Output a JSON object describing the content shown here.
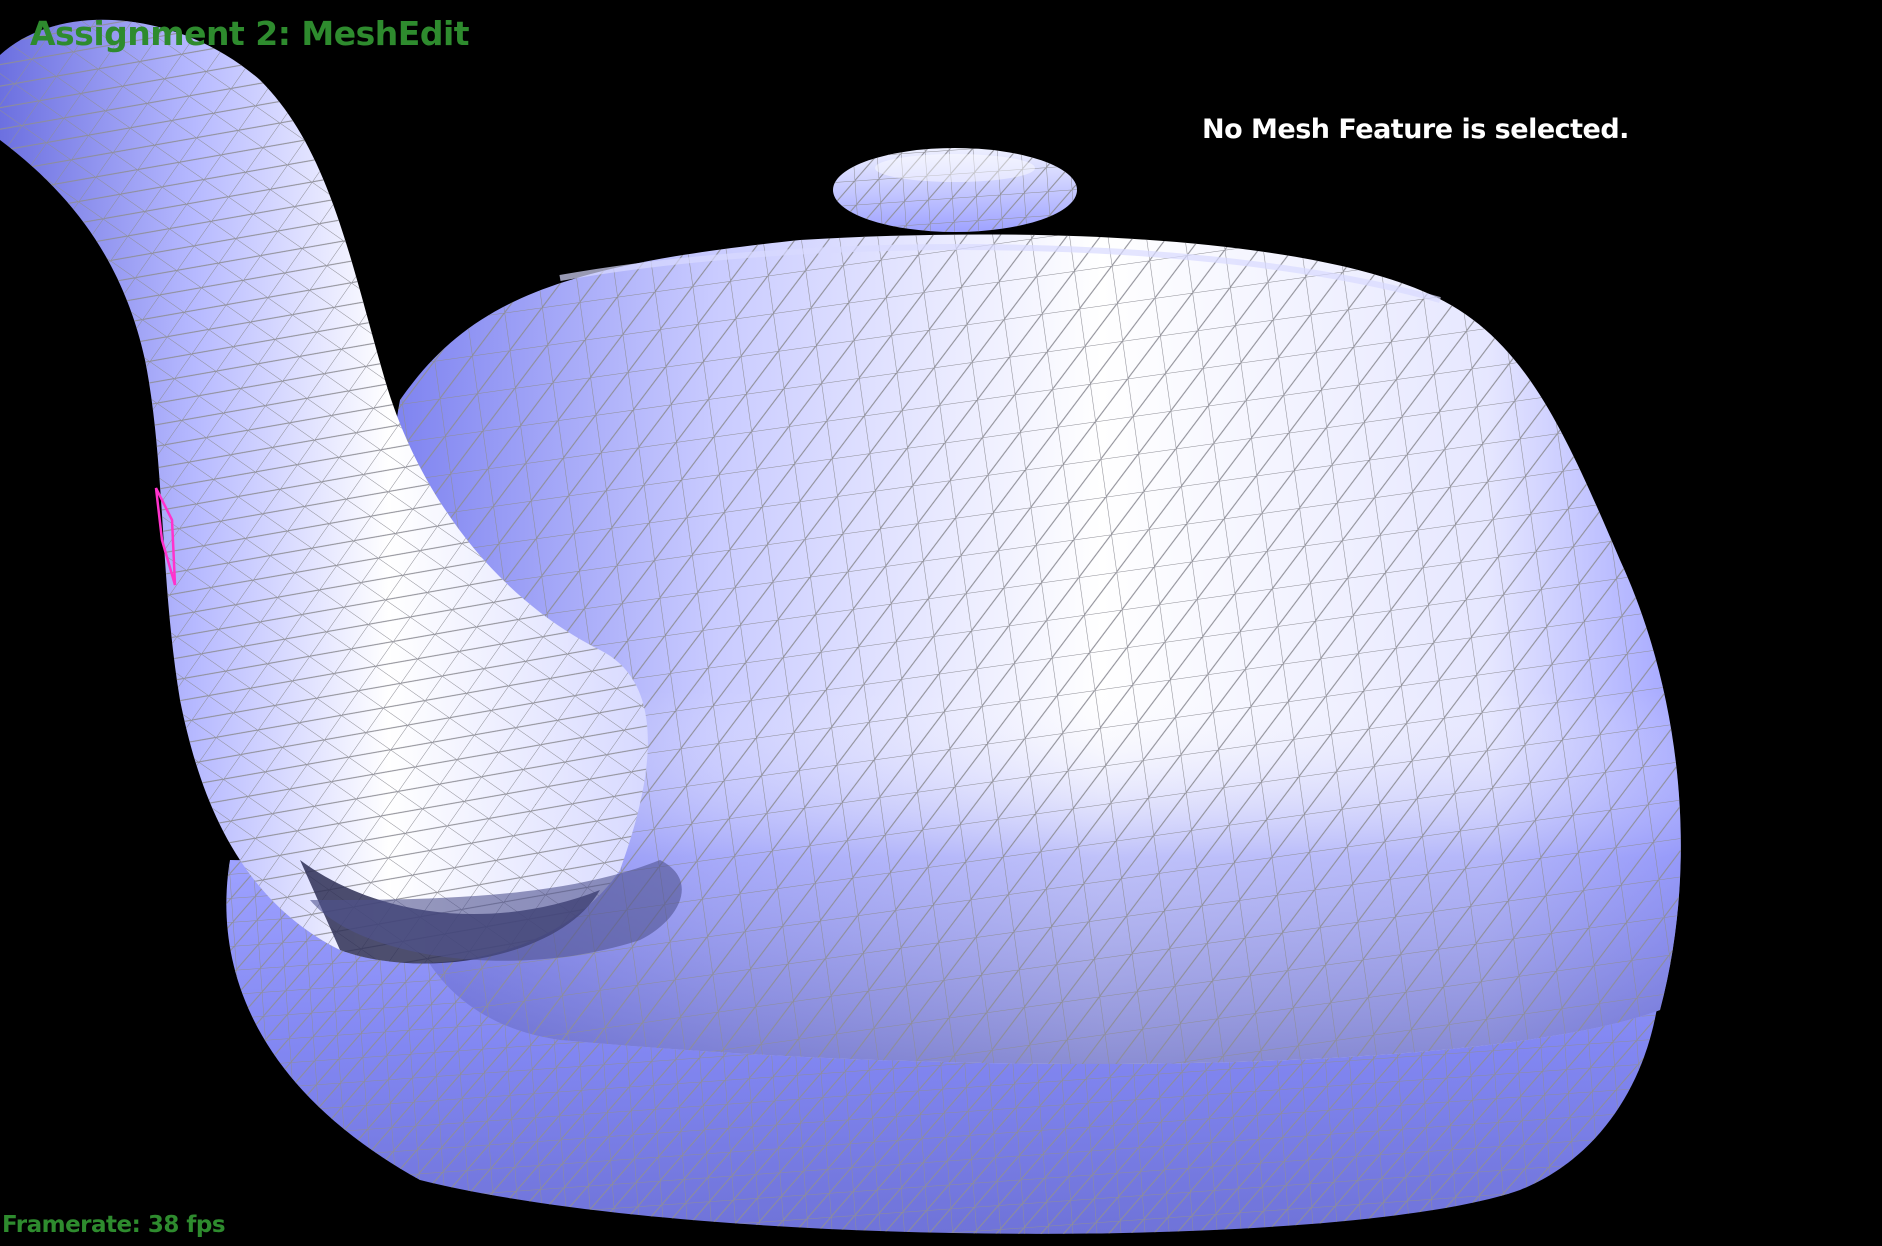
{
  "app": {
    "title": "Assignment 2: MeshEdit"
  },
  "status": {
    "selection": "No Mesh Feature is selected."
  },
  "stats": {
    "framerate": "Framerate: 38 fps"
  },
  "colors": {
    "background": "#000000",
    "title": "#2e8b2e",
    "status_text": "#ffffff",
    "mesh_base": "#a3a6ff",
    "mesh_highlight": "#ffffff",
    "mesh_shadow": "#3a3a6a",
    "wireframe": "#9a9a9a",
    "selection_highlight": "#ff33cc"
  },
  "icons": {
    "teapot_mesh": "teapot-mesh-icon"
  }
}
